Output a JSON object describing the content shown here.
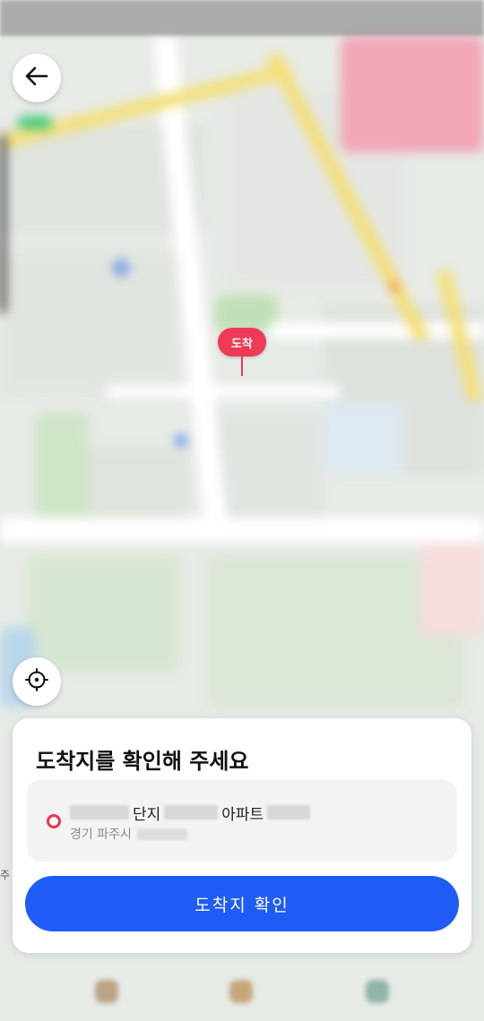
{
  "map": {
    "pin_label": "도착",
    "left_edge_label": "주"
  },
  "sheet": {
    "title": "도착지를 확인해 주세요",
    "address": {
      "line1_segments": [
        "단지",
        "아파트"
      ],
      "line2_prefix": "경기 파주시"
    },
    "confirm_label": "도착지 확인"
  },
  "colors": {
    "accent_blue": "#1e5cf5",
    "pin_red": "#f03a55"
  },
  "icons": {
    "back": "arrow-left-icon",
    "locate": "crosshair-icon",
    "address_marker": "location-dot-icon"
  }
}
